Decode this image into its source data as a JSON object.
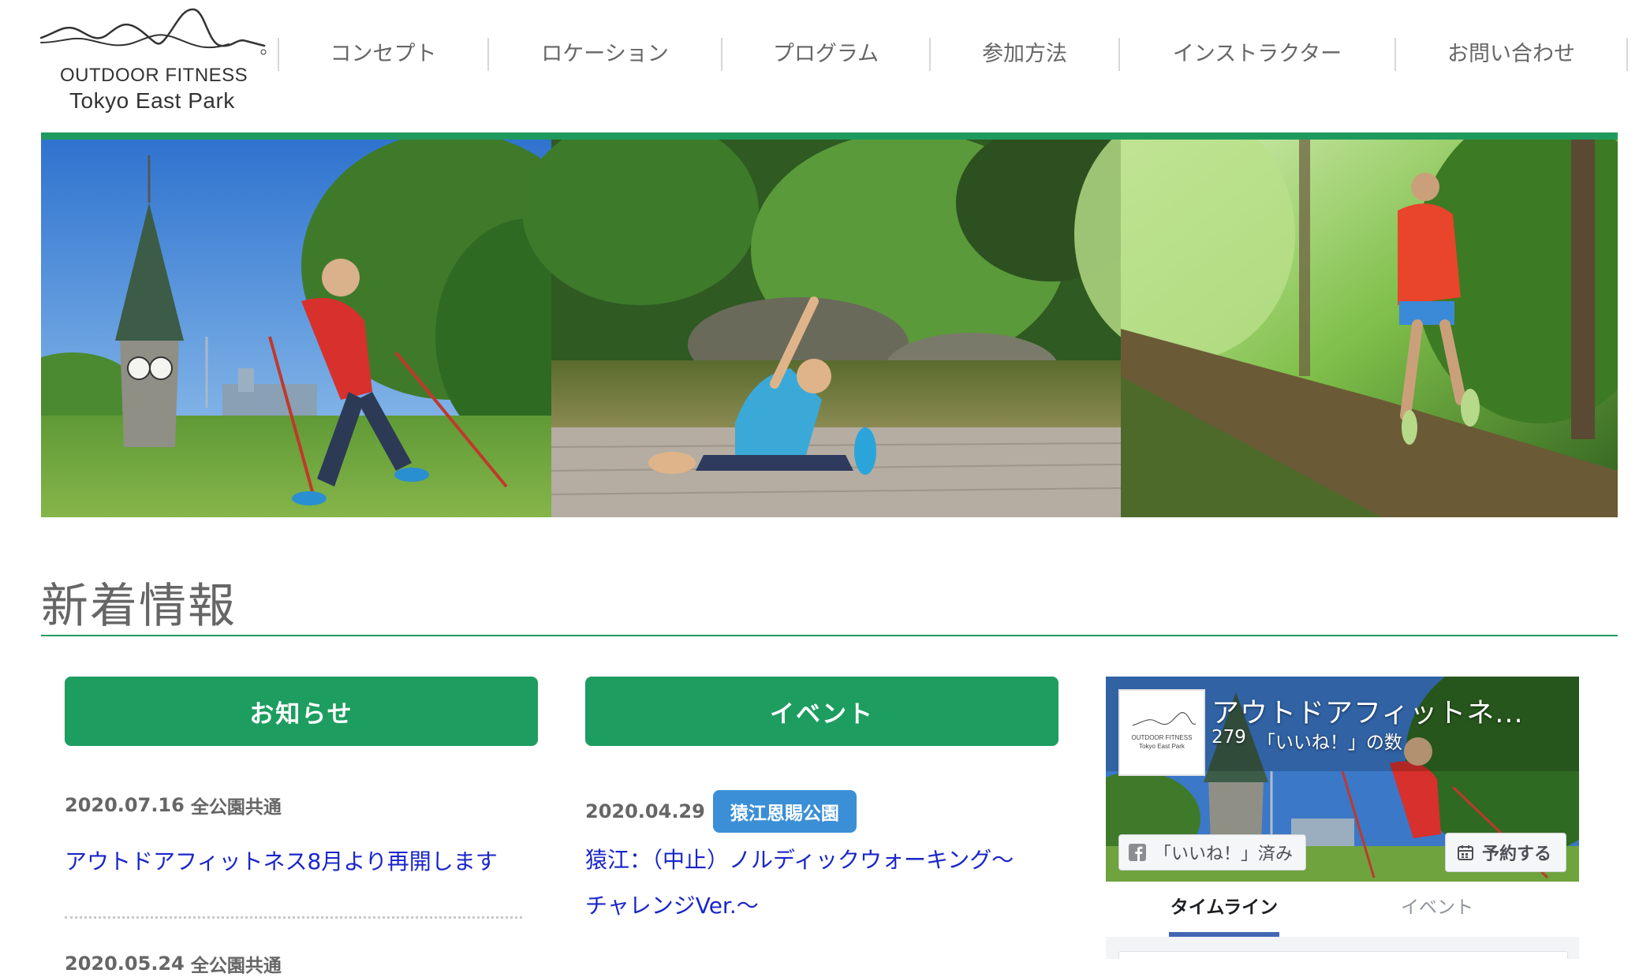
{
  "logo": {
    "line1": "OUTDOOR FITNESS",
    "line2": "Tokyo East Park",
    "icon": "mountain-wave-logo"
  },
  "nav": {
    "items": [
      {
        "label": "コンセプト"
      },
      {
        "label": "ロケーション"
      },
      {
        "label": "プログラム"
      },
      {
        "label": "参加方法"
      },
      {
        "label": "インストラクター"
      },
      {
        "label": "お問い合わせ"
      }
    ]
  },
  "hero": {
    "panels": [
      "nordic-walking-photo",
      "stretching-photo",
      "trail-running-photo"
    ]
  },
  "news": {
    "title": "新着情報",
    "notice": {
      "tab_label": "お知らせ",
      "posts": [
        {
          "date": "2020.07.16",
          "category": "全公園共通",
          "title": "アウトドアフィットネス8月より再開します"
        },
        {
          "date": "2020.05.24",
          "category": "全公園共通"
        }
      ]
    },
    "event": {
      "tab_label": "イベント",
      "posts": [
        {
          "date": "2020.04.29",
          "badge": "猿江恩賜公園",
          "title_line1": "猿江：（中止）ノルディックウォーキング〜",
          "title_line2": "チャレンジVer.〜"
        }
      ]
    }
  },
  "facebook": {
    "page_name": "アウトドアフィットネ...",
    "like_count": "279",
    "like_label": "「いいね！」の数",
    "liked_button": "「いいね！」済み",
    "book_button": "予約する",
    "tabs": [
      "タイムライン",
      "イベント"
    ],
    "thumb_line1": "OUTDOOR FITNESS",
    "thumb_line2": "Tokyo East Park",
    "colors": {
      "accent": "#4267b2"
    }
  },
  "colors": {
    "brand_green": "#1d9d5f",
    "badge_blue": "#3b8fd6",
    "link_blue": "#1a26c8"
  }
}
